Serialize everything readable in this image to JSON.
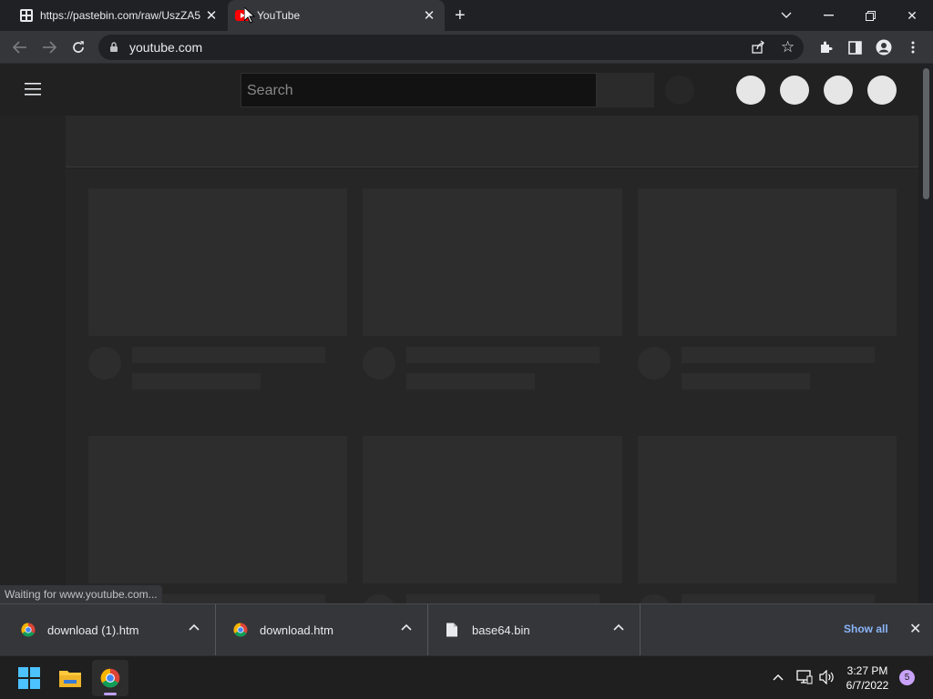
{
  "browser": {
    "tabs": [
      {
        "title": "https://pastebin.com/raw/UszZA5",
        "icon": "pastebin-favicon"
      },
      {
        "title": "YouTube",
        "icon": "youtube-favicon",
        "active": true
      }
    ],
    "new_tab_icon": "plus-icon",
    "window_controls": [
      "tab-search-icon",
      "minimize-icon",
      "restore-icon",
      "close-icon"
    ],
    "address": "youtube.com",
    "toolbar_icons": [
      "back-icon",
      "forward-icon",
      "reload-icon",
      "lock-icon",
      "share-icon",
      "star-icon",
      "extensions-icon",
      "side-panel-icon",
      "profile-icon",
      "menu-icon"
    ],
    "status_text": "Waiting for www.youtube.com..."
  },
  "page": {
    "search_placeholder": "Search",
    "placeholder_tiles_per_row": 3
  },
  "downloads": {
    "items": [
      {
        "name": "download (1).htm",
        "icon": "chrome-file-icon"
      },
      {
        "name": "download.htm",
        "icon": "chrome-file-icon"
      },
      {
        "name": "base64.bin",
        "icon": "file-icon"
      }
    ],
    "show_all_label": "Show all"
  },
  "taskbar": {
    "apps": [
      "windows-start-icon",
      "file-explorer-icon",
      "chrome-icon"
    ],
    "time": "3:27 PM",
    "date": "6/7/2022",
    "notification_count": "5"
  }
}
